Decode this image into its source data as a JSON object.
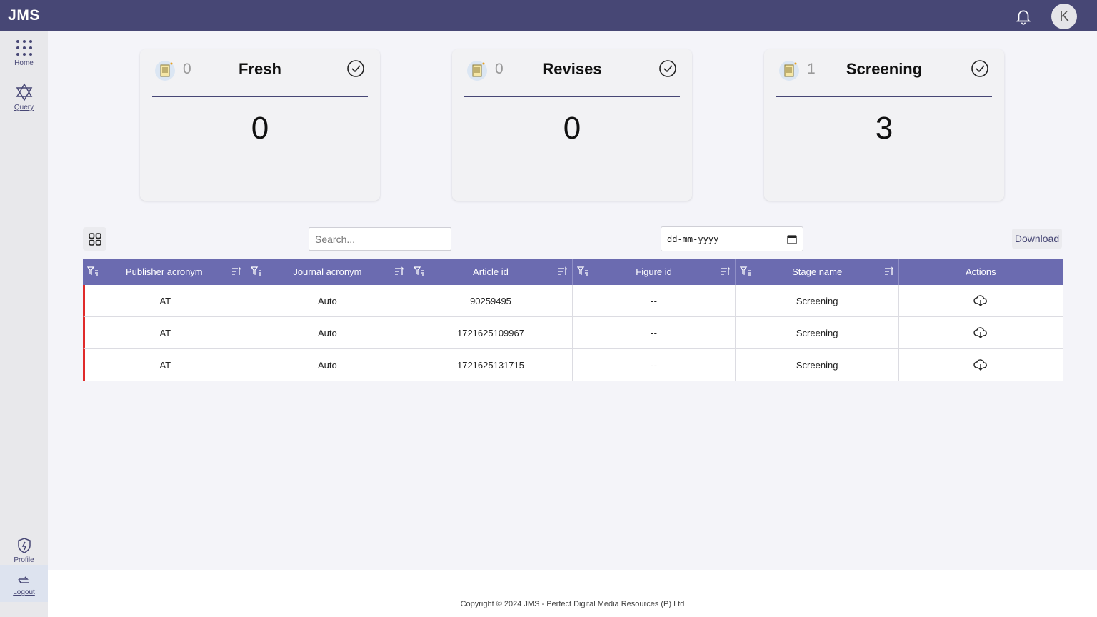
{
  "app": {
    "logo": "JMS"
  },
  "header": {
    "avatar_initial": "K"
  },
  "sidebar": {
    "items": [
      {
        "label": "Home",
        "icon": "grid-dots-icon"
      },
      {
        "label": "Query",
        "icon": "graph-node-icon"
      }
    ],
    "bottom": [
      {
        "label": "Profile",
        "icon": "shield-bolt-icon"
      },
      {
        "label": "Logout",
        "icon": "logout-arrow-icon"
      }
    ]
  },
  "cards": [
    {
      "small_count": "0",
      "title": "Fresh",
      "count": "0"
    },
    {
      "small_count": "0",
      "title": "Revises",
      "count": "0"
    },
    {
      "small_count": "1",
      "title": "Screening",
      "count": "3"
    }
  ],
  "toolbar": {
    "search_placeholder": "Search...",
    "date_placeholder": "dd-mm-yyyy",
    "download_label": "Download"
  },
  "table": {
    "columns": [
      "Publisher acronym",
      "Journal acronym",
      "Article id",
      "Figure id",
      "Stage name",
      "Actions"
    ],
    "rows": [
      [
        "AT",
        "Auto",
        "90259495",
        "--",
        "Screening"
      ],
      [
        "AT",
        "Auto",
        "1721625109967",
        "--",
        "Screening"
      ],
      [
        "AT",
        "Auto",
        "1721625131715",
        "--",
        "Screening"
      ]
    ]
  },
  "footer": {
    "copyright": "Copyright © 2024 JMS - Perfect Digital Media Resources (P) Ltd"
  },
  "colors": {
    "header": "#474775",
    "table_header": "#6b6bb0",
    "row_marker": "#e02a2a"
  }
}
